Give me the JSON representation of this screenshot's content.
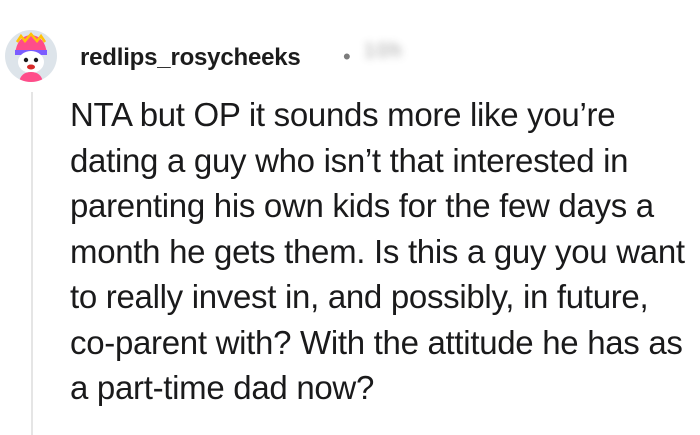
{
  "comment": {
    "author": "redlips_rosycheeks",
    "separator": "•",
    "timestamp": "10h",
    "body": "NTA but OP it sounds more like you’re dating a guy who isn’t that interested in parenting his own kids for the few days a month he gets them. Is this a guy you want to really invest in, and possibly, in future, co-parent with? With the attitude he has as a part-time dad now?"
  },
  "avatar": {
    "icon": "snoo-avatar-icon",
    "colors": {
      "background": "#dde4ea",
      "hat": "#ff4d8a",
      "hat_band": "#ffc107",
      "face": "#ffffff",
      "mouth": "#d62828"
    }
  }
}
